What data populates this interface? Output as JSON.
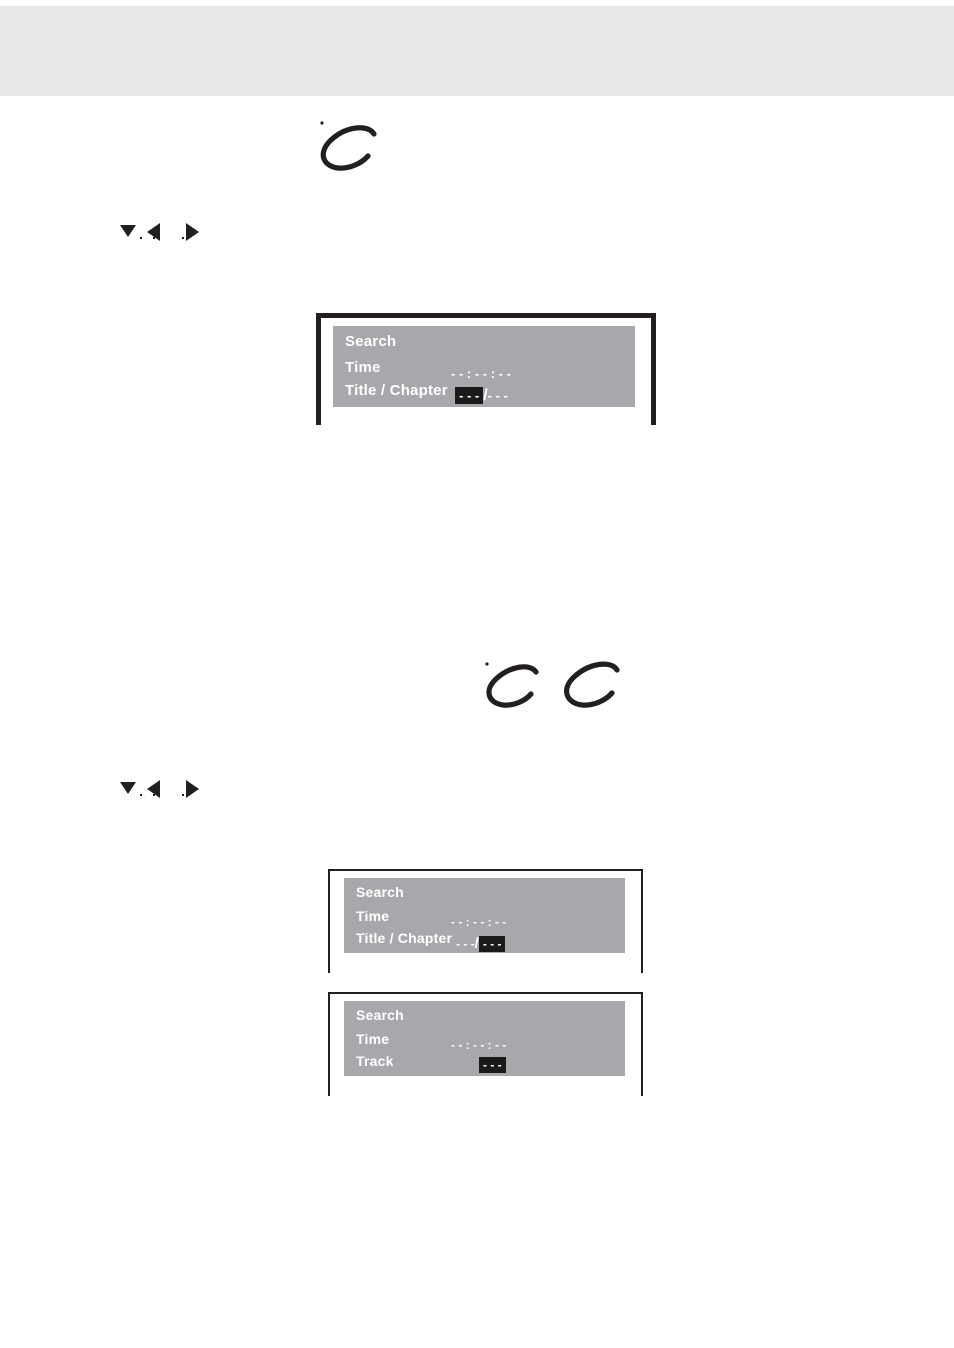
{
  "page": {
    "background_color": "#ffffff",
    "header_band_color": "#e6e7e9",
    "osd_panel_color": "#a6a8ab",
    "osd_text_color": "#ffffff",
    "osd_highlight_color": "#1a1a1a",
    "frame_color": "#231f20"
  },
  "annotations": {
    "pen_marks": [
      {
        "name": "pen-mark-c-1",
        "glyph": "C"
      },
      {
        "name": "pen-mark-c-2",
        "glyph": "C"
      },
      {
        "name": "pen-mark-c-3",
        "glyph": "C"
      }
    ],
    "marker_rows": [
      {
        "name": "button-markers-row-1",
        "icons": [
          "triangle-down-icon",
          "triangle-left-icon",
          "triangle-right-icon"
        ]
      },
      {
        "name": "button-markers-row-2",
        "icons": [
          "triangle-down-icon",
          "triangle-left-icon",
          "triangle-right-icon"
        ]
      }
    ]
  },
  "osd_screens": [
    {
      "id": "osd-title-chapter-title-selected",
      "title": "Search",
      "rows": [
        {
          "label": "Time",
          "value_parts": [
            {
              "text": "- - : - - : - -",
              "highlighted": false
            }
          ]
        },
        {
          "label": "Title / Chapter",
          "value_parts": [
            {
              "text": "- - -",
              "highlighted": true
            },
            {
              "text": "/",
              "highlighted": false
            },
            {
              "text": "- - -",
              "highlighted": false
            }
          ]
        }
      ]
    },
    {
      "id": "osd-title-chapter-chapter-selected",
      "title": "Search",
      "rows": [
        {
          "label": "Time",
          "value_parts": [
            {
              "text": "- - : - - : - -",
              "highlighted": false
            }
          ]
        },
        {
          "label": "Title / Chapter",
          "value_parts": [
            {
              "text": "- - -",
              "highlighted": false
            },
            {
              "text": "/",
              "highlighted": false
            },
            {
              "text": "- - -",
              "highlighted": true
            }
          ]
        }
      ]
    },
    {
      "id": "osd-track-selected",
      "title": "Search",
      "rows": [
        {
          "label": "Time",
          "value_parts": [
            {
              "text": "- - : - - : - -",
              "highlighted": false
            }
          ]
        },
        {
          "label": "Track",
          "value_parts": [
            {
              "text": "- - -",
              "highlighted": true
            }
          ]
        }
      ]
    }
  ]
}
